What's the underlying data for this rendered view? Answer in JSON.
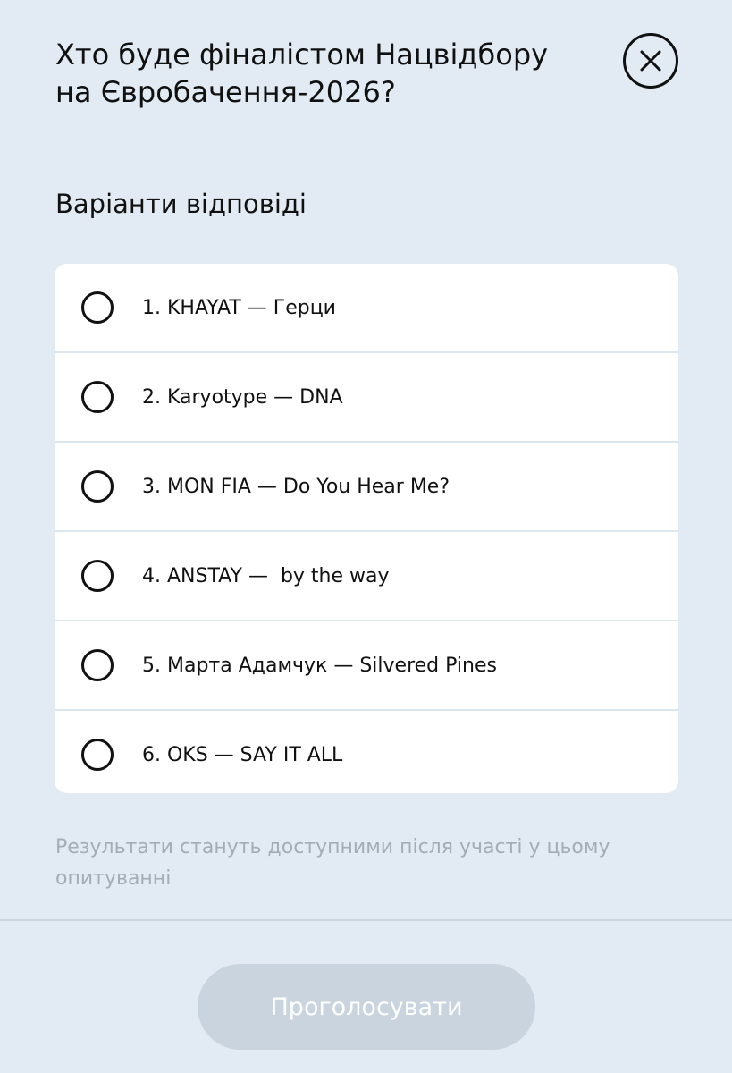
{
  "poll": {
    "title": "Хто буде фіналістом Нацвідбору на Євробачення-2026?",
    "options_heading": "Варіанти відповіді",
    "options": [
      {
        "label": "1. KHAYAT — Герци",
        "selected": false
      },
      {
        "label": "2. Karyotype — DNA",
        "selected": false
      },
      {
        "label": "3. MON FIA — Do You Hear Me?",
        "selected": false
      },
      {
        "label": "4. ANSTAY —  by the way",
        "selected": false
      },
      {
        "label": "5. Марта Адамчук — Silvered Pines",
        "selected": false
      },
      {
        "label": "6. OKS — SAY IT ALL",
        "selected": false
      }
    ],
    "results_note": "Результати стануть доступними після участі у цьому опитуванні",
    "vote_button_label": "Проголосувати",
    "vote_button_enabled": false
  },
  "icons": {
    "close": "close-icon",
    "radio": "radio-unchecked-icon"
  },
  "colors": {
    "background": "#e2ebf3",
    "card": "#ffffff",
    "text": "#111111",
    "muted_text": "#a4adb6",
    "button_disabled": "#c9d4de"
  }
}
